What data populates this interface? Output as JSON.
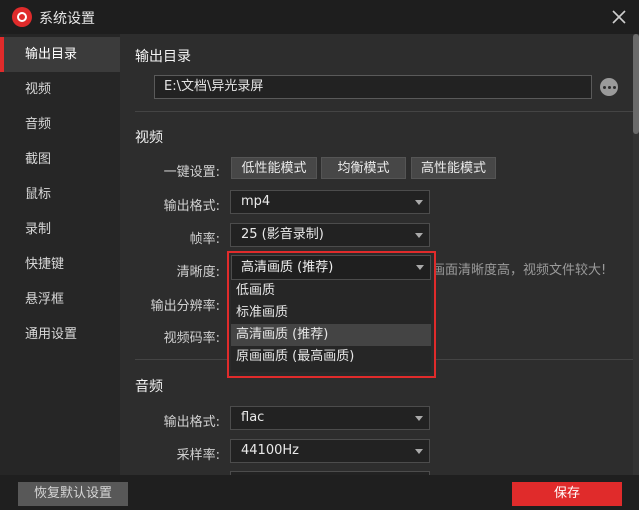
{
  "window": {
    "title": "系统设置"
  },
  "sidebar": {
    "items": [
      {
        "label": "输出目录",
        "active": true
      },
      {
        "label": "视频"
      },
      {
        "label": "音频"
      },
      {
        "label": "截图"
      },
      {
        "label": "鼠标"
      },
      {
        "label": "录制"
      },
      {
        "label": "快捷键"
      },
      {
        "label": "悬浮框"
      },
      {
        "label": "通用设置"
      }
    ]
  },
  "output_dir": {
    "title": "输出目录",
    "path_value": "E:\\文档\\异光录屏",
    "more_icon": "more-icon"
  },
  "video": {
    "title": "视频",
    "preset": {
      "label": "一键设置:",
      "options": [
        "低性能模式",
        "均衡模式",
        "高性能模式"
      ]
    },
    "format": {
      "label": "输出格式:",
      "value": "mp4"
    },
    "fps": {
      "label": "帧率:",
      "value": "25 (影音录制)"
    },
    "quality": {
      "label": "清晰度:",
      "value": "高清画质 (推荐)",
      "hint": "画面清晰度高，视频文件较大!",
      "options": [
        "低画质",
        "标准画质",
        "高清画质 (推荐)",
        "原画画质 (最高画质)"
      ],
      "selected_index": 2
    },
    "resolution": {
      "label": "输出分辨率:"
    },
    "bitrate": {
      "label": "视频码率:"
    }
  },
  "audio": {
    "title": "音频",
    "format": {
      "label": "输出格式:",
      "value": "flac"
    },
    "sample_rate": {
      "label": "采样率:",
      "value": "44100Hz"
    }
  },
  "footer": {
    "reset_label": "恢复默认设置",
    "save_label": "保存"
  },
  "colors": {
    "accent": "#e02b2b",
    "background": "#2d2d2d",
    "sidebar": "#262626"
  }
}
